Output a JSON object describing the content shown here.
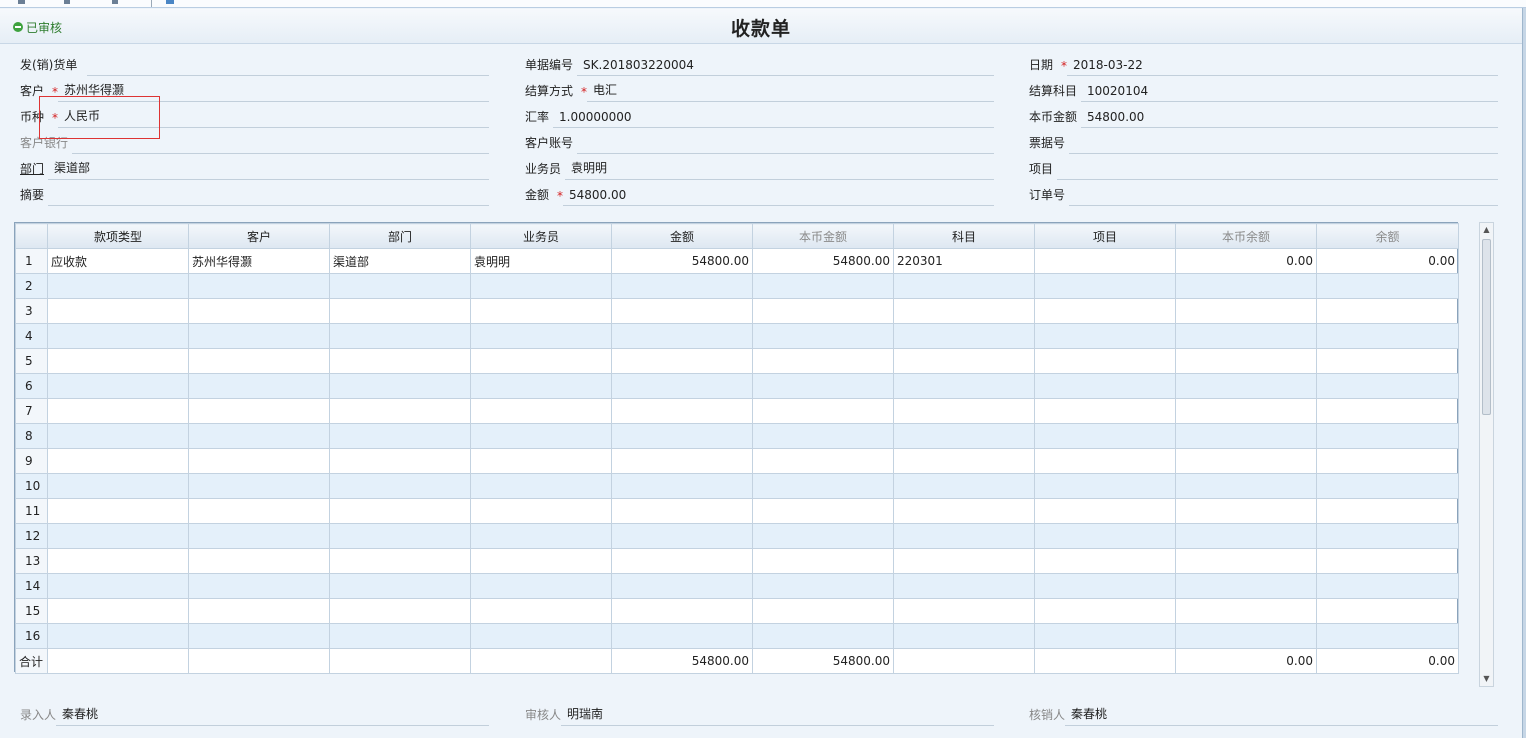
{
  "status": {
    "label": "已审核"
  },
  "form": {
    "title": "收款单"
  },
  "header": {
    "c1": [
      {
        "label": "发(销)货单",
        "value": "",
        "required": false
      },
      {
        "label": "客户",
        "value": "苏州华得灏",
        "required": true
      },
      {
        "label": "币种",
        "value": "人民币",
        "required": true
      },
      {
        "label": "客户银行",
        "value": "",
        "required": false
      },
      {
        "label": "部门",
        "value": "渠道部",
        "required": false
      },
      {
        "label": "摘要",
        "value": "",
        "required": false
      }
    ],
    "c2": [
      {
        "label": "单据编号",
        "value": "SK.201803220004",
        "required": false
      },
      {
        "label": "结算方式",
        "value": "电汇",
        "required": true
      },
      {
        "label": "汇率",
        "value": "1.00000000",
        "required": false
      },
      {
        "label": "客户账号",
        "value": "",
        "required": false
      },
      {
        "label": "业务员",
        "value": "袁明明",
        "required": false
      },
      {
        "label": "金额",
        "value": "54800.00",
        "required": true
      }
    ],
    "c3": [
      {
        "label": "日期",
        "value": "2018-03-22",
        "required": true
      },
      {
        "label": "结算科目",
        "value": "10020104",
        "required": false
      },
      {
        "label": "本币金额",
        "value": "54800.00",
        "required": false
      },
      {
        "label": "票据号",
        "value": "",
        "required": false
      },
      {
        "label": "项目",
        "value": "",
        "required": false
      },
      {
        "label": "订单号",
        "value": "",
        "required": false
      }
    ]
  },
  "grid": {
    "columns": [
      "",
      "款项类型",
      "客户",
      "部门",
      "业务员",
      "金额",
      "本币金额",
      "科目",
      "项目",
      "本币余额",
      "余额"
    ],
    "rows": [
      [
        "1",
        "应收款",
        "苏州华得灏",
        "渠道部",
        "袁明明",
        "54800.00",
        "54800.00",
        "220301",
        "",
        "0.00",
        "0.00"
      ],
      [
        "2",
        "",
        "",
        "",
        "",
        "",
        "",
        "",
        "",
        "",
        ""
      ],
      [
        "3",
        "",
        "",
        "",
        "",
        "",
        "",
        "",
        "",
        "",
        ""
      ],
      [
        "4",
        "",
        "",
        "",
        "",
        "",
        "",
        "",
        "",
        "",
        ""
      ],
      [
        "5",
        "",
        "",
        "",
        "",
        "",
        "",
        "",
        "",
        "",
        ""
      ],
      [
        "6",
        "",
        "",
        "",
        "",
        "",
        "",
        "",
        "",
        "",
        ""
      ],
      [
        "7",
        "",
        "",
        "",
        "",
        "",
        "",
        "",
        "",
        "",
        ""
      ],
      [
        "8",
        "",
        "",
        "",
        "",
        "",
        "",
        "",
        "",
        "",
        ""
      ],
      [
        "9",
        "",
        "",
        "",
        "",
        "",
        "",
        "",
        "",
        "",
        ""
      ],
      [
        "10",
        "",
        "",
        "",
        "",
        "",
        "",
        "",
        "",
        "",
        ""
      ],
      [
        "11",
        "",
        "",
        "",
        "",
        "",
        "",
        "",
        "",
        "",
        ""
      ],
      [
        "12",
        "",
        "",
        "",
        "",
        "",
        "",
        "",
        "",
        "",
        ""
      ],
      [
        "13",
        "",
        "",
        "",
        "",
        "",
        "",
        "",
        "",
        "",
        ""
      ],
      [
        "14",
        "",
        "",
        "",
        "",
        "",
        "",
        "",
        "",
        "",
        ""
      ],
      [
        "15",
        "",
        "",
        "",
        "",
        "",
        "",
        "",
        "",
        "",
        ""
      ],
      [
        "16",
        "",
        "",
        "",
        "",
        "",
        "",
        "",
        "",
        "",
        ""
      ]
    ],
    "total": [
      "合计",
      "",
      "",
      "",
      "",
      "54800.00",
      "54800.00",
      "",
      "",
      "0.00",
      "0.00"
    ]
  },
  "footer": {
    "entered_by_label": "录入人",
    "entered_by": "秦春桃",
    "reviewer_label": "审核人",
    "reviewer": "明瑞南",
    "writeoff_label": "核销人",
    "writeoff_by": "秦春桃"
  }
}
